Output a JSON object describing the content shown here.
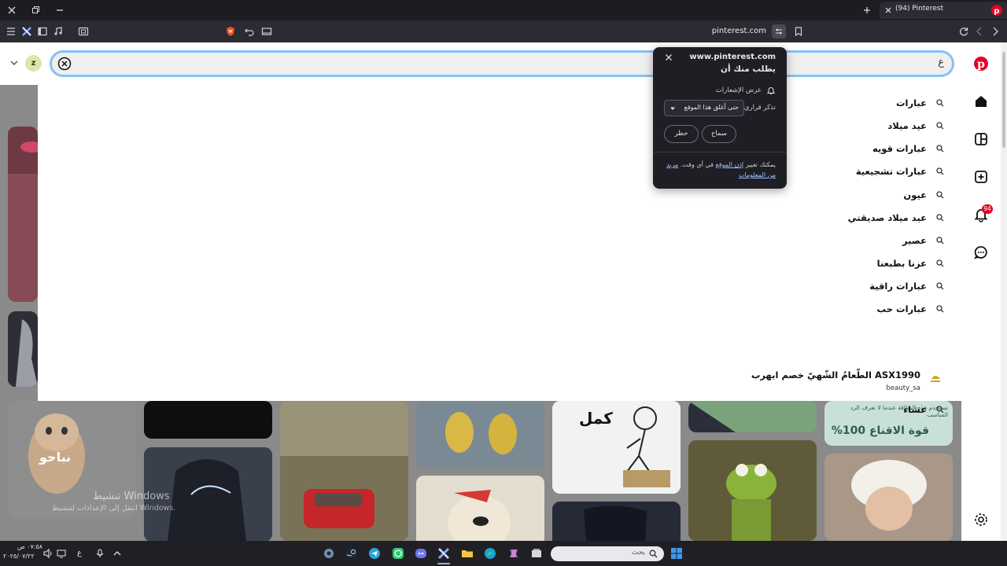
{
  "window": {
    "tab_title": "(94) Pinterest",
    "url": "pinterest.com"
  },
  "search": {
    "query": "ع",
    "suggestions": [
      {
        "label": "عبارات"
      },
      {
        "label": "عيد ميلاد"
      },
      {
        "label": "عبارات قويه"
      },
      {
        "label": "عبارات تشجيعية"
      },
      {
        "label": "عيون"
      },
      {
        "label": "عيد ميلاد صديقتي"
      },
      {
        "label": "عصير"
      },
      {
        "label": "عزنا بطبعنا"
      },
      {
        "label": "عبارات راقية"
      },
      {
        "label": "عبارات حب"
      }
    ],
    "product": {
      "title": "الطّعامُ الشّهيّ خصم ايهرب ASX1990",
      "account": "beauty_sa"
    },
    "last_suggestion": "عشاء"
  },
  "permission_popup": {
    "site": "www.pinterest.com",
    "subtitle": "يطلب منك أن",
    "permission": "عرض الإشعارات",
    "remember_label": "تذكر قراري",
    "remember_value": "حتى أغلق هذا الموقع",
    "allow": "سماح",
    "block": "حظر",
    "footer_prefix": "يمكنك تغيير",
    "footer_link1": "إذن الموقع",
    "footer_middle": "في أي وقت.",
    "footer_link2": "مزيد من المعلومات"
  },
  "profile": {
    "initial": "z"
  },
  "notifications": {
    "count": "94"
  },
  "pins": {
    "cat_caption": "نباحو",
    "sign_text": "كمل",
    "promo_line1": "تستخدم هذه البطاقة عندما لا تعرف الرد المناسب",
    "promo_line2": "قوة الاقناع 100%",
    "watermark_line1": "تنشيط Windows",
    "watermark_line2": "انتقل إلى الإعدادات لتنشيط Windows."
  },
  "taskbar": {
    "search_placeholder": "بحث",
    "lang": "ع",
    "time": "٠٧:٥٨ ص",
    "date": "٢٠٢٥/٠٧/٢٢"
  },
  "colors": {
    "pinterest_red": "#e60023",
    "search_focus": "#86c1f5",
    "dark_chrome": "#1c1c21"
  }
}
